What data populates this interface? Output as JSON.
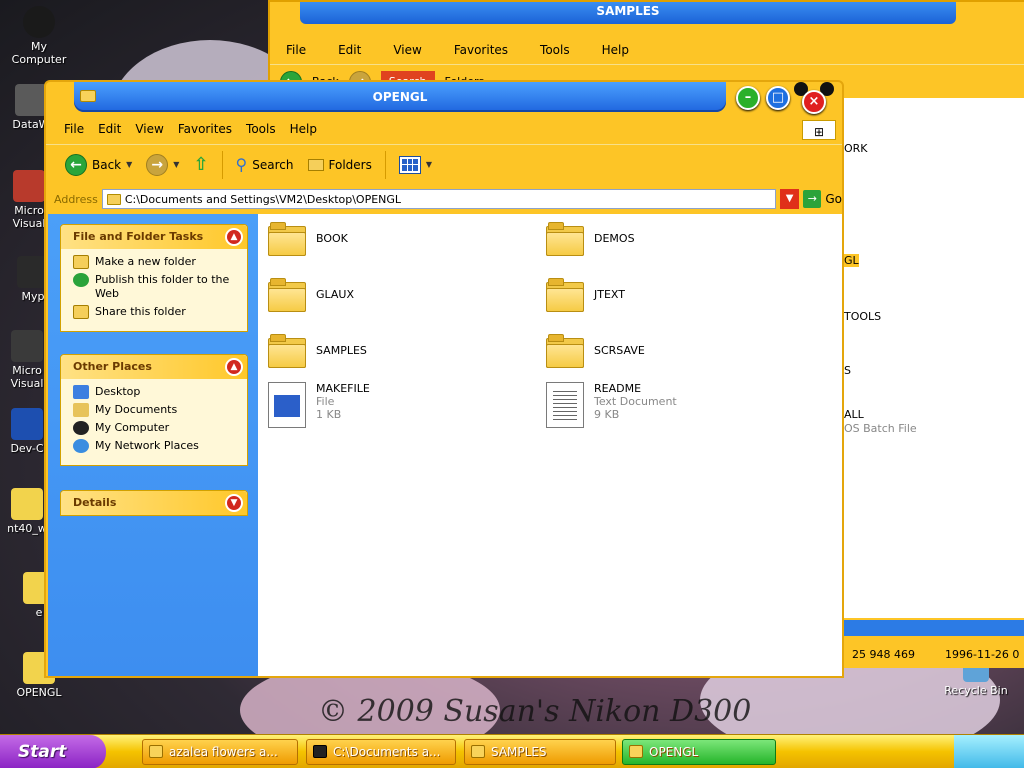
{
  "desktop": {
    "icons": [
      {
        "label": "My\nComputer",
        "name": "desktop-icon-my-computer"
      },
      {
        "label": "DataW",
        "name": "desktop-icon-dataw"
      },
      {
        "label": "Micro\nVisual",
        "name": "desktop-icon-micro-visual-1"
      },
      {
        "label": "Myp",
        "name": "desktop-icon-myp"
      },
      {
        "label": "Micro\nVisual",
        "name": "desktop-icon-micro-visual-2"
      },
      {
        "label": "Dev-C",
        "name": "desktop-icon-dev-c"
      },
      {
        "label": "nt40_w",
        "name": "desktop-icon-nt40"
      },
      {
        "label": "e",
        "name": "desktop-icon-e"
      },
      {
        "label": "OPENGL",
        "name": "desktop-icon-opengl"
      }
    ],
    "recycle_bin": "Recycle Bin",
    "watermark": "© 2009 Susan's Nikon D300"
  },
  "bg_window": {
    "title": "SAMPLES",
    "menu": [
      "File",
      "Edit",
      "View",
      "Favorites",
      "Tools",
      "Help"
    ],
    "back_label": "Back",
    "search_label": "Search",
    "folders_label": "Folders",
    "visible_items": [
      "ORK",
      "GL",
      "TOOLS",
      "S",
      "ALL",
      "OS Batch File"
    ],
    "status_size": "25 948 469",
    "status_date": "1996-11-26 0"
  },
  "window": {
    "title": "OPENGL",
    "menu": [
      "File",
      "Edit",
      "View",
      "Favorites",
      "Tools",
      "Help"
    ],
    "toolbar": {
      "back": "Back",
      "search": "Search",
      "folders": "Folders"
    },
    "address_label": "Address",
    "address_value": "C:\\Documents and Settings\\VM2\\Desktop\\OPENGL",
    "go_label": "Go"
  },
  "left_pane": {
    "file_tasks": {
      "title": "File and Folder Tasks",
      "items": [
        "Make a new folder",
        "Publish this folder to the Web",
        "Share this folder"
      ]
    },
    "other_places": {
      "title": "Other Places",
      "items": [
        "Desktop",
        "My Documents",
        "My Computer",
        "My Network Places"
      ]
    },
    "details": {
      "title": "Details"
    }
  },
  "files": [
    {
      "name": "BOOK",
      "type": "folder"
    },
    {
      "name": "DEMOS",
      "type": "folder"
    },
    {
      "name": "GLAUX",
      "type": "folder"
    },
    {
      "name": "JTEXT",
      "type": "folder"
    },
    {
      "name": "SAMPLES",
      "type": "folder"
    },
    {
      "name": "SCRSAVE",
      "type": "folder"
    },
    {
      "name": "MAKEFILE",
      "type": "File",
      "size": "1 KB"
    },
    {
      "name": "README",
      "type": "Text Document",
      "size": "9 KB"
    }
  ],
  "taskbar": {
    "start_label": "Start",
    "buttons": [
      {
        "label": "azalea flowers a..."
      },
      {
        "label": "C:\\Documents a..."
      },
      {
        "label": "SAMPLES"
      },
      {
        "label": "OPENGL",
        "active": true
      }
    ]
  },
  "colors": {
    "window_frame": "#fdc526",
    "title_blue": "#1f65de",
    "task_pane": "#4b9ff8",
    "start_purple": "#8a22c3"
  }
}
